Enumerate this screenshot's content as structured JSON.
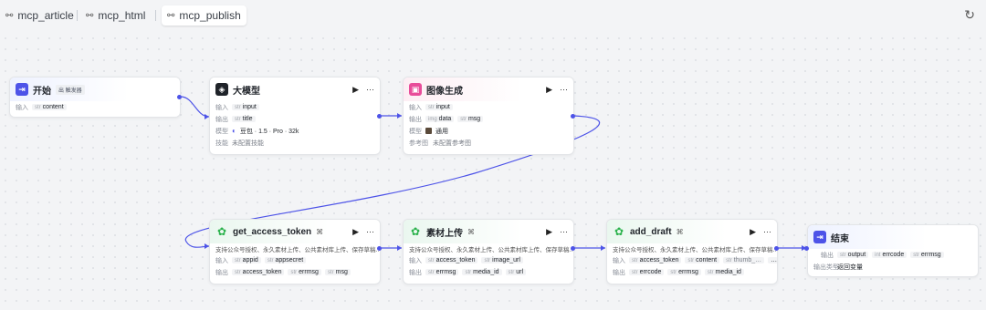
{
  "tabs": [
    {
      "label": "mcp_article",
      "icon": "workflow-icon"
    },
    {
      "label": "mcp_html",
      "icon": "workflow-icon"
    },
    {
      "label": "mcp_publish",
      "icon": "workflow-icon"
    }
  ],
  "colors": {
    "accent": "#4d53e8",
    "start": "#4d53e8",
    "image": "#e84d9a",
    "wechat": "#2bb24c",
    "llm": "#1f2329"
  },
  "nodes": {
    "start": {
      "title": "开始",
      "badge": "出 触发器",
      "input_label": "输入",
      "input_type": "str",
      "input_name": "content"
    },
    "llm": {
      "title": "大模型",
      "input_label": "输入",
      "input_type": "str",
      "input_name": "input",
      "output_label": "输出",
      "output_type": "str",
      "output_name": "title",
      "model_label": "模型",
      "model_value": "豆包 · 1.5 · Pro · 32k",
      "skill_label": "技能",
      "skill_value": "未配置技能"
    },
    "image": {
      "title": "图像生成",
      "input_label": "输入",
      "input_type": "str",
      "input_name": "input",
      "output_label": "输出",
      "output1_type": "img",
      "output1_name": "data",
      "output2_type": "str",
      "output2_name": "msg",
      "model_label": "模型",
      "model_value": "通用",
      "ref_label": "参考图",
      "ref_value": "未配置参考图"
    },
    "token": {
      "title": "get_access_token",
      "desc": "支持公众号授权、永久素材上传、公共素材库上传、保存草稿…",
      "input_label": "输入",
      "in1_type": "str",
      "in1_name": "appid",
      "in2_type": "str",
      "in2_name": "appsecret",
      "output_label": "输出",
      "out1_type": "str",
      "out1_name": "access_token",
      "out2_type": "str",
      "out2_name": "errmsg",
      "out3_type": "str",
      "out3_name": "msg"
    },
    "upload": {
      "title": "素材上传",
      "desc": "支持公众号授权、永久素材上传、公共素材库上传、保存草稿…",
      "input_label": "输入",
      "in1_type": "str",
      "in1_name": "access_token",
      "in2_type": "str",
      "in2_name": "image_url",
      "output_label": "输出",
      "out1_type": "str",
      "out1_name": "errmsg",
      "out2_type": "str",
      "out2_name": "media_id",
      "out3_type": "str",
      "out3_name": "url"
    },
    "draft": {
      "title": "add_draft",
      "desc": "支持公众号授权、永久素材上传、公共素材库上传、保存草稿…",
      "input_label": "输入",
      "in1_type": "str",
      "in1_name": "access_token",
      "in2_type": "str",
      "in2_name": "content",
      "in3_type": "str",
      "in3_name": "thumb_…",
      "more": "…",
      "output_label": "输出",
      "out1_type": "str",
      "out1_name": "errcode",
      "out2_type": "str",
      "out2_name": "errmsg",
      "out3_type": "str",
      "out3_name": "media_id"
    },
    "end": {
      "title": "结束",
      "output_label": "输出",
      "out1_type": "str",
      "out1_name": "output",
      "out2_type": "int",
      "out2_name": "errcode",
      "out3_type": "str",
      "out3_name": "errmsg",
      "return_label": "输出类型",
      "return_value": "返回变量"
    }
  },
  "controls": {
    "run": "▶",
    "more": "···",
    "refresh": "↻",
    "workflow": "⌘"
  }
}
